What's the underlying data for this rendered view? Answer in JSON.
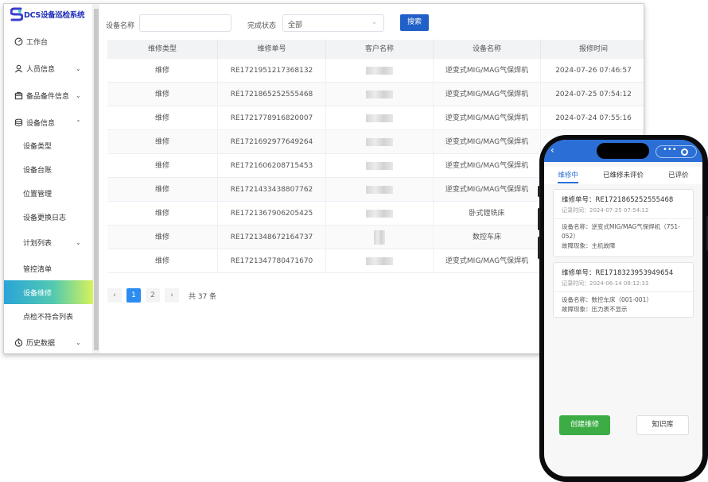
{
  "app": {
    "logo_text": "DCS设备巡检系统"
  },
  "sidebar": {
    "items": [
      {
        "label": "工作台",
        "icon": "dashboard-icon",
        "chevron": ""
      },
      {
        "label": "人员信息",
        "icon": "user-icon",
        "chevron": "⌄"
      },
      {
        "label": "备品备件信息",
        "icon": "package-icon",
        "chevron": "⌄"
      },
      {
        "label": "设备信息",
        "icon": "database-icon",
        "chevron": "⌃"
      },
      {
        "label": "设备类型",
        "icon": "",
        "chevron": ""
      },
      {
        "label": "设备台账",
        "icon": "",
        "chevron": ""
      },
      {
        "label": "位置管理",
        "icon": "",
        "chevron": ""
      },
      {
        "label": "设备更换日志",
        "icon": "",
        "chevron": ""
      },
      {
        "label": "计划列表",
        "icon": "",
        "chevron": "⌄"
      },
      {
        "label": "管控清单",
        "icon": "",
        "chevron": ""
      },
      {
        "label": "设备维修",
        "icon": "",
        "chevron": ""
      },
      {
        "label": "点检不符合列表",
        "icon": "",
        "chevron": ""
      },
      {
        "label": "历史数据",
        "icon": "history-icon",
        "chevron": "⌄"
      }
    ]
  },
  "filters": {
    "device_name_label": "设备名称",
    "status_label": "完成状态",
    "status_value": "全部",
    "search_label": "搜索"
  },
  "table": {
    "headers": [
      "维修类型",
      "维修单号",
      "客户名称",
      "设备名称",
      "报修时间"
    ],
    "rows": [
      {
        "type": "维修",
        "no": "RE1721951217368132",
        "device": "逆变式MIG/MAG气保焊机",
        "time": "2024-07-26 07:46:57"
      },
      {
        "type": "维修",
        "no": "RE1721865252555468",
        "device": "逆变式MIG/MAG气保焊机",
        "time": "2024-07-25 07:54:12"
      },
      {
        "type": "维修",
        "no": "RE1721778916820007",
        "device": "逆变式MIG/MAG气保焊机",
        "time": "2024-07-24 07:55:16"
      },
      {
        "type": "维修",
        "no": "RE1721692977649264",
        "device": "逆变式MIG/MAG气保焊机",
        "time": ""
      },
      {
        "type": "维修",
        "no": "RE1721606208715453",
        "device": "逆变式MIG/MAG气保焊机",
        "time": ""
      },
      {
        "type": "维修",
        "no": "RE1721433438807762",
        "device": "逆变式MIG/MAG气保焊机",
        "time": ""
      },
      {
        "type": "维修",
        "no": "RE1721367906205425",
        "device": "卧式镗铣床",
        "time": ""
      },
      {
        "type": "维修",
        "no": "RE1721348672164737",
        "device": "数控车床",
        "time": ""
      },
      {
        "type": "维修",
        "no": "RE1721347780471670",
        "device": "逆变式MIG/MAG气保焊机",
        "time": ""
      }
    ]
  },
  "pagination": {
    "prev": "‹",
    "page1": "1",
    "page2": "2",
    "next": "›",
    "total": "共 37 条"
  },
  "phone": {
    "tabs": [
      "维修中",
      "已维修未评价",
      "已评价"
    ],
    "cards": [
      {
        "no": "维修单号：RE1721865252555468",
        "time": "记录时间：2024-07-25 07:54:12",
        "device": "设备名称：逆变式MIG/MAG气保焊机（751-052）",
        "fault": "故障现象：主机故障"
      },
      {
        "no": "维修单号：RE1718323953949654",
        "time": "记录时间：2024-06-14 08:12:33",
        "device": "设备名称：数控车床（001-001）",
        "fault": "故障现象：压力表不显示"
      }
    ],
    "create_label": "创建维修",
    "kb_label": "知识库"
  },
  "colors": {
    "brand": "#1f2fb8",
    "accent": "#2160c8",
    "phone_bar": "#2b6fd6",
    "create": "#3dac45"
  }
}
